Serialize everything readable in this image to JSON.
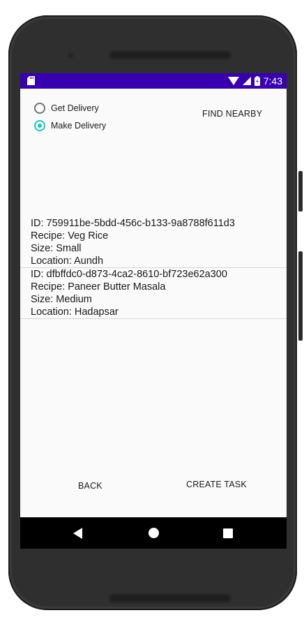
{
  "status_bar": {
    "time": "7:43"
  },
  "delivery_mode": {
    "options": [
      {
        "label": "Get Delivery",
        "selected": false
      },
      {
        "label": "Make Delivery",
        "selected": true
      }
    ],
    "accent_color": "#18c9bd"
  },
  "find_nearby_label": "FIND NEARBY",
  "orders": [
    {
      "id_line": "ID: 759911be-5bdd-456c-b133-9a8788f611d3",
      "recipe_line": "Recipe: Veg Rice",
      "size_line": "Size: Small",
      "location_line": "Location: Aundh"
    },
    {
      "id_line": "ID: dfbffdc0-d873-4ca2-8610-bf723e62a300",
      "recipe_line": "Recipe: Paneer Butter Masala",
      "size_line": "Size: Medium",
      "location_line": "Location: Hadapsar"
    }
  ],
  "back_label": "BACK",
  "create_task_label": "CREATE TASK",
  "colors": {
    "status_bar": "#3700b3",
    "background": "#fafafa",
    "nav_bar": "#000000"
  },
  "icons": {
    "status_left": "sd-card-icon",
    "status_right": [
      "wifi-icon",
      "cell-signal-icon",
      "battery-icon"
    ],
    "nav": [
      "back-icon",
      "home-icon",
      "recents-icon"
    ]
  }
}
